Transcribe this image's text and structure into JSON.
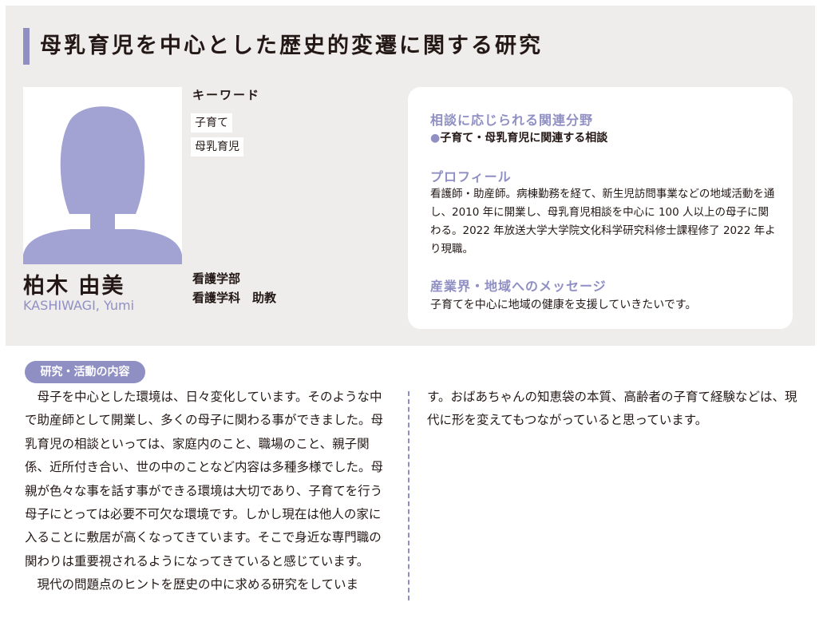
{
  "title": "母乳育児を中心とした歴史的変遷に関する研究",
  "person": {
    "name": "柏木 由美",
    "name_roman": "KASHIWAGI, Yumi",
    "avatar_icon": "person-silhouette-icon",
    "faculty": "看護学部",
    "department_position": "看護学科　助教"
  },
  "keywords": {
    "label": "キーワード",
    "items": [
      "子育て",
      "母乳育児"
    ]
  },
  "card": {
    "fields_heading": "相談に応じられる関連分野",
    "fields_item": "子育て・母乳育児に関連する相談",
    "profile_heading": "プロフィール",
    "profile_text": "看護師・助産師。病棟勤務を経て、新生児訪問事業などの地域活動を通し、2010 年に開業し、母乳育児相談を中心に 100 人以上の母子に関わる。2022 年放送大学大学院文化科学研究科修士課程修了 2022 年より現職。",
    "message_heading": "産業界・地域へのメッセージ",
    "message_text": "子育てを中心に地域の健康を支援していきたいです。"
  },
  "research": {
    "label": "研究・活動の内容",
    "left_para1": "母子を中心とした環境は、日々変化しています。そのような中で助産師として開業し、多くの母子に関わる事ができました。母乳育児の相談といっては、家庭内のこと、職場のこと、親子関係、近所付き合い、世の中のことなど内容は多種多様でした。母親が色々な事を話す事ができる環境は大切であり、子育てを行う母子にとっては必要不可欠な環境です。しかし現在は他人の家に入ることに敷居が高くなってきています。そこで身近な専門職の関わりは重要視されるようになってきていると感じています。",
    "left_para2": "現代の問題点のヒントを歴史の中に求める研究をしていま",
    "right_text": "す。おばあちゃんの知恵袋の本質、高齢者の子育て経験などは、現代に形を変えてもつながっていると思っています。"
  },
  "colors": {
    "accent": "#8f8fc4",
    "band": "#efedeb",
    "text": "#231815"
  }
}
